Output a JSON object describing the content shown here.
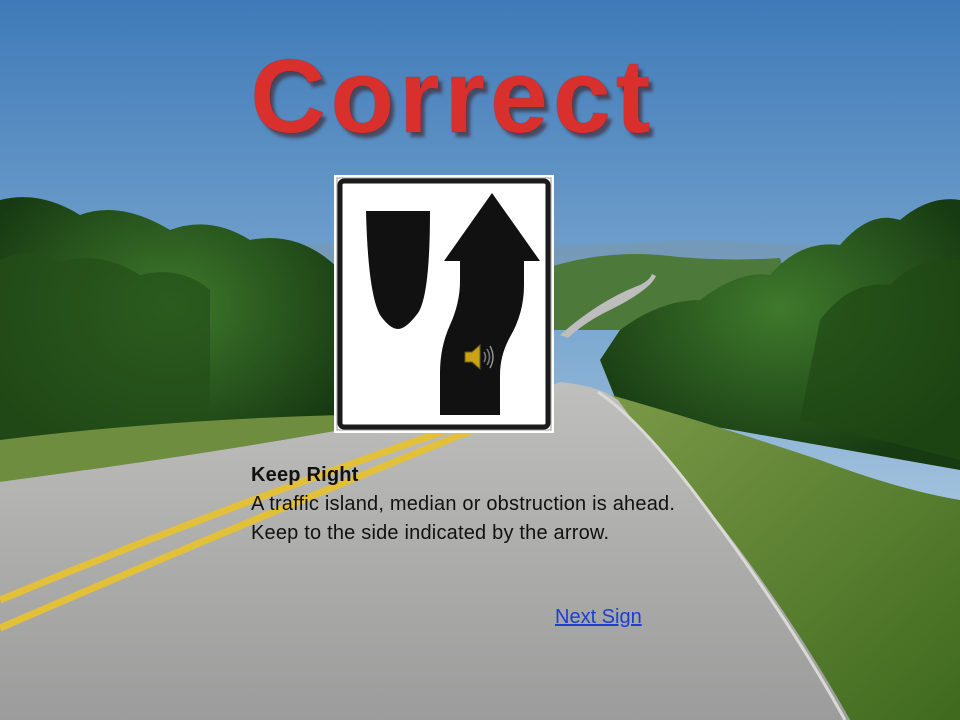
{
  "slide": {
    "title": "Correct",
    "sign": {
      "name": "Keep Right",
      "description": "A traffic island, median or obstruction is ahead. Keep to the side indicated by the arrow."
    },
    "audio_icon": "speaker-icon",
    "next_link_label": "Next Sign"
  }
}
